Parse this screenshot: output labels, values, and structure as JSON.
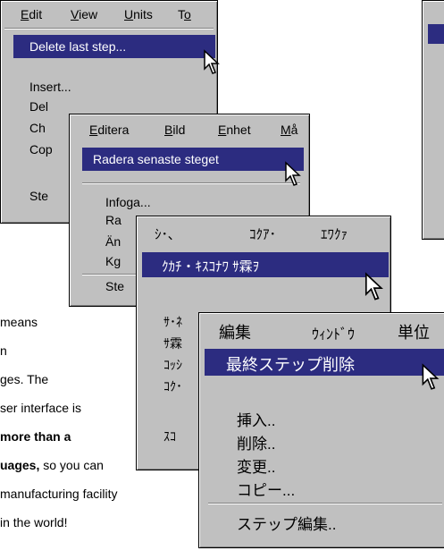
{
  "menu1": {
    "bar": [
      "Edit",
      "View",
      "Units",
      "To"
    ],
    "highlight": "Delete last step...",
    "items": [
      "Insert...",
      "Del",
      "Ch",
      "Cop",
      "Ste"
    ]
  },
  "menu2": {
    "bar": [
      "Editera",
      "Bild",
      "Enhet",
      "Må"
    ],
    "highlight": "Radera senaste steget",
    "items": [
      "Infoga...",
      "Ra",
      "Än",
      "Kg",
      "Ste"
    ]
  },
  "menu3": {
    "bar": [
      "ｼ･､",
      "ｺｸｱ･",
      "ｴﾜｸｧ"
    ],
    "highlight": "ｸｶﾁ・ｷｽｺﾅﾜ ｻ霖ｦ",
    "items": [
      "ｻ･ﾈ",
      "ｻ霖",
      "ｺｯｼ",
      "ｺｸ･",
      "ｽｺ"
    ]
  },
  "menu4": {
    "bar": [
      "編集",
      "ｳｨﾝﾄﾞｳ",
      "単位"
    ],
    "highlight": "最終ステップ削除",
    "items": [
      "挿入..",
      "削除..",
      "変更..",
      "コピー...",
      "ステップ編集.."
    ]
  },
  "paragraph": {
    "lines": [
      "means",
      "n",
      "ges. The",
      "ser interface is",
      "more than a",
      "uages, so you can",
      "manufacturing facility",
      "in the world!"
    ]
  },
  "colors": {
    "menu_bg": "#c0c0c0",
    "highlight": "#2c2c80",
    "highlight_text": "#ffffff"
  },
  "icons": {
    "cursor": "arrow-cursor-icon"
  }
}
